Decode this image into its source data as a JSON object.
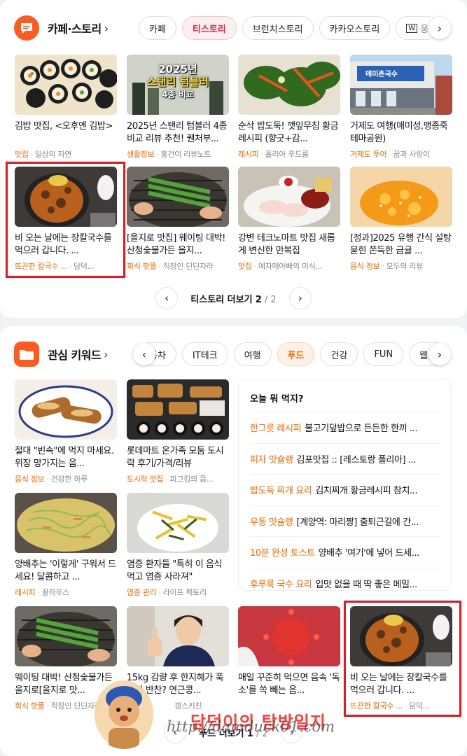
{
  "cafe_section": {
    "title": "카페·스토리",
    "chips": [
      "카페",
      "티스토리",
      "브런치스토리",
      "카카오스토리",
      "웅"
    ],
    "active_chip": "티스토리",
    "items": [
      {
        "title": "김밥 맛집, <오후엔 김밥>",
        "category": "맛집",
        "source": "일상의 자연"
      },
      {
        "title": "2025년 스탠리 텀블러 4종 비교 리뷰 추천! 퀜처부...",
        "category": "생활정보",
        "source": "홍건이 리뷰노트"
      },
      {
        "title": "순삭 밥도둑! 깻잎무침 황금레시피 (향긋+감...",
        "category": "레시피",
        "source": "홀리아 푸드룸"
      },
      {
        "title": "거제도 여행(매미성,맹종죽테마공원)",
        "category": "거제도 투어",
        "source": "꿈과 사랑이"
      },
      {
        "title": "비 오는 날에는 장칼국수를 먹으러 갑니다. ...",
        "category": "뜨끈한 칼국수 ...",
        "source": "담덕..."
      },
      {
        "title": "[을지로 맛집] 웨이팅 대박! 산청숯불가든 을지...",
        "category": "회식 핫플",
        "source": "직장인 딘딘자라"
      },
      {
        "title": "강변 테크노마트 맛집 새롭게 변신한 만복집",
        "category": "맛집",
        "source": "예자매아빠의 미식..."
      },
      {
        "title": "[정과]2025 유행 간식 설탕 묻힌 쫀득한 금귤 ...",
        "category": "음식 정보",
        "source": "모두의 리뷰"
      }
    ],
    "thumb_texts": {
      "tumbler_l1": "2025년",
      "tumbler_l2": "스탠리 텀블러",
      "tumbler_l3": "4종 비교",
      "sign": "매미촌국수"
    },
    "pager": {
      "label": "티스토리 더보기",
      "current": "2",
      "sep": "/",
      "total": "2"
    }
  },
  "keyword_section": {
    "title": "관심 키워드",
    "chips": [
      "동차",
      "IT테크",
      "여행",
      "푸드",
      "건강",
      "FUN",
      "웹툰"
    ],
    "active_chip": "푸드",
    "items": [
      {
        "title": "절대 \"빈속\"에 먹지 마세요. 위장 망가지는 음...",
        "category": "음식 정보",
        "source": "건강한 하루"
      },
      {
        "title": "롯데마트 온가족 모둠 도시락 후기/가격/리뷰",
        "category": "도시락 맛집",
        "source": "피그킴의 음..."
      },
      {
        "title": "양배추는 '이렇게' 구워서 드세요! 달콤하고 ...",
        "category": "레시피",
        "source": "꿀하우스"
      },
      {
        "title": "염증 환자들 \"특히 이 음식먹고 염증 사라져\"",
        "category": "염증 관리",
        "source": "라이프 팩토리"
      },
      {
        "title": "웨이팅 대박! 산청숯불가든 을지로[을지로 맛...",
        "category": "회식 핫플",
        "source": "직장인 딘딘자라"
      },
      {
        "title": "15kg 감량 후 한지혜가 푹 빠진 반찬? 연근콩...",
        "category": "",
        "source": "갱스키친"
      },
      {
        "title": "매일 꾸준히 먹으면 음속 '독소'를 쏙 빼는 음...",
        "category": "",
        "source": ""
      },
      {
        "title": "비 오는 날에는 장칼국수를 먹으러 갑니다. ...",
        "category": "뜨끈한 칼국수 ...",
        "source": "담덕..."
      }
    ],
    "panel": {
      "title": "오늘 뭐 먹지?",
      "rows": [
        {
          "tag": "한그릇 레시피",
          "text": "불고기덮밥으로 든든한 한끼 ..."
        },
        {
          "tag": "피자 맛슐랭",
          "text": "김포맛집 :: [레스토랑 폴리아] ..."
        },
        {
          "tag": "밥도둑 찌개 요리",
          "text": "김치찌개 황금레시피 참치..."
        },
        {
          "tag": "우동 맛슐랭",
          "text": "[계양역: 마리짱] 출퇴근길에 간..."
        },
        {
          "tag": "10분 완성 토스트",
          "text": "양배추 '여기'에 넣어 드세..."
        },
        {
          "tag": "후루룩 국수 요리",
          "text": "입맛 없을 때 딱 좋은 메밀..."
        }
      ]
    },
    "pager": {
      "label": "푸드 더보기",
      "current": "1",
      "sep": "/",
      "total": "2"
    }
  },
  "watermark": {
    "name": "담덕이의 탐방일지",
    "url": "http://damduck01.com"
  },
  "colors": {
    "accent": "#ff6a00",
    "tistory_active": "#e0264d",
    "highlight_box": "#e8181e",
    "brand_icon": "#ff5a1f"
  }
}
